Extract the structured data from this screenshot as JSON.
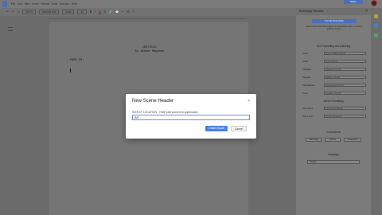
{
  "menu": {
    "items": [
      "File",
      "Edit",
      "View",
      "Insert",
      "Format",
      "Tools",
      "Add-ons",
      "Help"
    ]
  },
  "header": {
    "share_label": "Share"
  },
  "toolbar": {
    "zoom": "100%",
    "style": "Normal text",
    "font": "Arial",
    "font_size": "11"
  },
  "document": {
    "title_line1": "UNTITLED",
    "title_line2": "By Jabbar Magnnoo",
    "transition": "FADE IN:"
  },
  "sidebar": {
    "title": "Screenplay Formatter",
    "main_button": "Format Screenplay",
    "note": "Select Text to Format to apply the Formatting style, or Convert Hotkeys button.",
    "section_text_formatting": "Text Formatting and Indenting",
    "rows": [
      {
        "label": "Scene",
        "value": "Scene Heading (Ctrl+1)"
      },
      {
        "label": "Action",
        "value": "Action (Ctrl+2)"
      },
      {
        "label": "Character",
        "value": "Character (Ctrl+3)"
      },
      {
        "label": "Dialogue",
        "value": "Dialogue (Ctrl+4)"
      },
      {
        "label": "Parenthetical",
        "value": "Parenthetical (Ctrl+5)"
      },
      {
        "label": "Trans",
        "value": "Transition (Ctrl+6)"
      }
    ],
    "section_scene_formatting": "Scene Formatting",
    "scene_rows": [
      {
        "label": "New Scene",
        "value": "Insert Scene Header"
      },
      {
        "label": "Scene Num",
        "value": "Number All Scenes"
      }
    ],
    "section_convenience": "Convenience",
    "convenience_buttons": [
      "Title Page",
      "Outline",
      "Characters"
    ],
    "section_language": "Language",
    "language_value": "English"
  },
  "modal": {
    "title": "New Scene Header",
    "label": "INT/EXT LOCATION - TIME (will convert to uppercase)",
    "input_value": "INT.",
    "ok_label": "Create Header",
    "cancel_label": "Cancel"
  }
}
